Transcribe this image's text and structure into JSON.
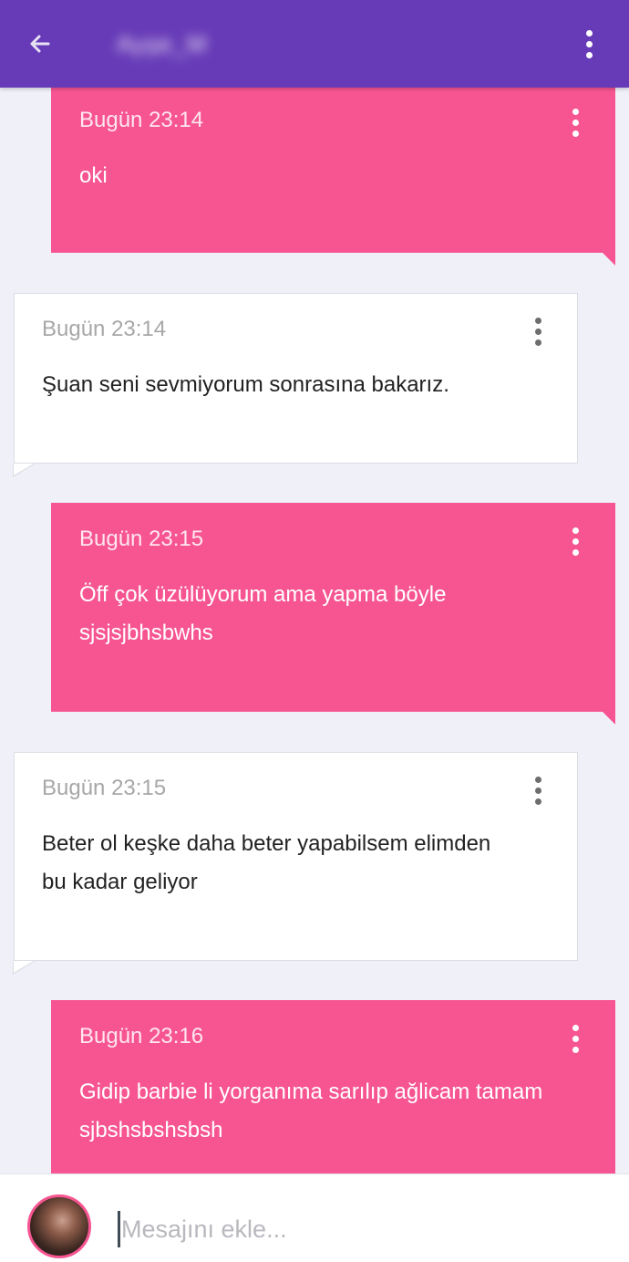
{
  "header": {
    "contact_name": "Ayşe_M",
    "back_icon": "arrow-back-icon",
    "menu_icon": "more-vert-icon",
    "color": "#673ab7"
  },
  "messages": [
    {
      "direction": "sent",
      "time": "Bugün 23:14",
      "lines": [
        "oki"
      ]
    },
    {
      "direction": "received",
      "time": "Bugün 23:14",
      "lines": [
        "Şuan seni sevmiyorum sonrasına bakarız."
      ]
    },
    {
      "direction": "sent",
      "time": "Bugün 23:15",
      "lines": [
        "Öff çok üzülüyorum ama yapma böyle",
        "sjsjsjbhsbwhs"
      ]
    },
    {
      "direction": "received",
      "time": "Bugün 23:15",
      "lines": [
        "Beter ol keşke daha beter yapabilsem elimden",
        "bu kadar geliyor"
      ]
    },
    {
      "direction": "sent",
      "time": "Bugün 23:16",
      "lines": [
        "Gidip barbie li yorganıma sarılıp ağlicam tamam",
        "sjbshsbshsbsh"
      ]
    }
  ],
  "composer": {
    "placeholder": "Mesajını ekle...",
    "value": ""
  },
  "colors": {
    "sent_bubble": "#f65591",
    "received_bubble": "#ffffff",
    "background": "#f0f0f8"
  }
}
